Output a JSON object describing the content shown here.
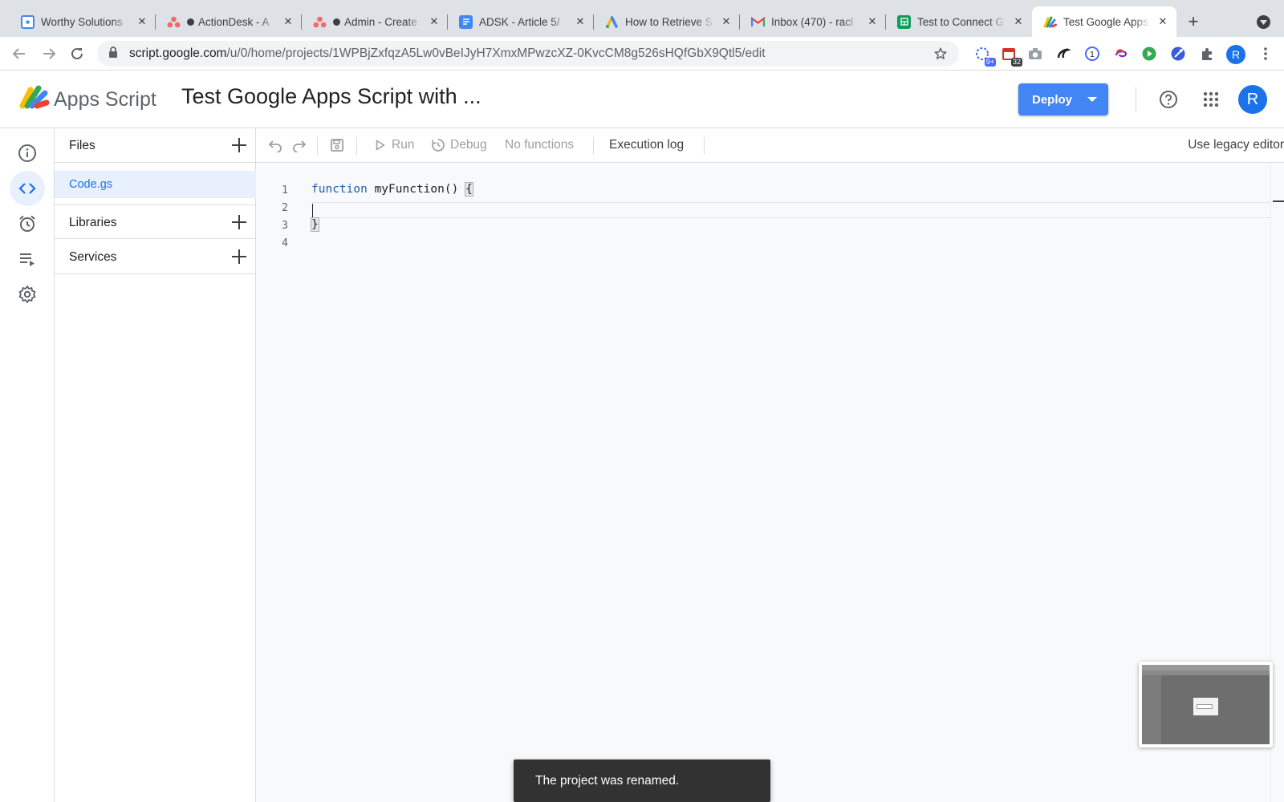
{
  "browser": {
    "tabs": [
      {
        "label": "Worthy Solutions",
        "favicon": "calendar-favicon",
        "color": "#4285f4",
        "dot": false
      },
      {
        "label": "ActionDesk - A",
        "favicon": "asana-favicon",
        "color": "#f06a6a",
        "dot": true
      },
      {
        "label": "Admin - Create",
        "favicon": "asana-favicon",
        "color": "#f06a6a",
        "dot": true
      },
      {
        "label": "ADSK - Article 5/",
        "favicon": "docs-favicon",
        "color": "#4285f4",
        "dot": false
      },
      {
        "label": "How to Retrieve S",
        "favicon": "ads-favicon",
        "color": "#4285f4",
        "dot": false
      },
      {
        "label": "Inbox (470) - racl",
        "favicon": "gmail-favicon",
        "color": "#ea4335",
        "dot": false
      },
      {
        "label": "Test to Connect G",
        "favicon": "sheets-favicon",
        "color": "#0f9d58",
        "dot": false
      },
      {
        "label": "Test Google Apps",
        "favicon": "apps-script-favicon",
        "color": "#fbbc04",
        "dot": false,
        "active": true
      }
    ],
    "url_host": "script.google.com",
    "url_path": "/u/0/home/projects/1WPBjZxfqzA5Lw0vBeIJyH7XmxMPwzcXZ-0KvcCM8g526sHQfGbX9Qtl5/edit",
    "extensions": [
      {
        "name": "puzzle-extension-icon",
        "badge": "9+"
      },
      {
        "name": "calendar-extension-icon",
        "badge": "32"
      },
      {
        "name": "camera-extension-icon"
      },
      {
        "name": "swirl-extension-icon"
      },
      {
        "name": "password-extension-icon"
      },
      {
        "name": "link-extension-icon"
      },
      {
        "name": "play-extension-icon"
      },
      {
        "name": "rocket-extension-icon"
      },
      {
        "name": "extensions-icon"
      }
    ],
    "profile_initial": "R"
  },
  "header": {
    "product": "Apps Script",
    "project_title": "Test Google Apps Script with ...",
    "deploy_label": "Deploy",
    "avatar_initial": "R",
    "accent": "#4285f4"
  },
  "rail": [
    {
      "name": "overview-icon"
    },
    {
      "name": "editor-icon",
      "active": true
    },
    {
      "name": "triggers-icon"
    },
    {
      "name": "executions-icon"
    },
    {
      "name": "settings-icon"
    }
  ],
  "files": {
    "files_label": "Files",
    "items": [
      {
        "label": "Code.gs"
      }
    ],
    "libraries_label": "Libraries",
    "services_label": "Services"
  },
  "toolbar": {
    "run_label": "Run",
    "debug_label": "Debug",
    "functions_label": "No functions",
    "execution_log_label": "Execution log",
    "legacy_label": "Use legacy editor"
  },
  "editor": {
    "lines": [
      {
        "num": "1",
        "keyword": "function",
        "rest": " myFunction() ",
        "bracket": "{"
      },
      {
        "num": "2",
        "keyword": "",
        "rest": "",
        "bracket": ""
      },
      {
        "num": "3",
        "keyword": "",
        "rest": "",
        "bracket": "}"
      },
      {
        "num": "4",
        "keyword": "",
        "rest": "",
        "bracket": ""
      }
    ]
  },
  "snackbar": {
    "message": "The project was renamed."
  }
}
